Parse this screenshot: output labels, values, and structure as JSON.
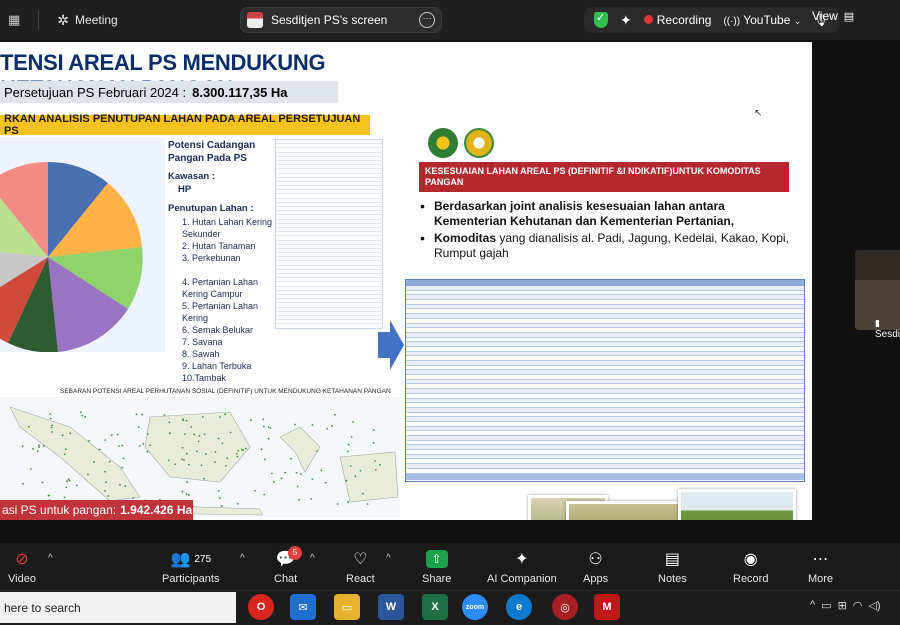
{
  "topbar": {
    "meeting_label": "Meeting",
    "share_title": "Sesditjen PS's screen",
    "recording_label": "Recording",
    "youtube_label": "YouTube",
    "view_label": "View"
  },
  "slide": {
    "title": "TENSI AREAL PS MENDUKUNG KETAHANAN PANGAN",
    "subtitle_prefix": "Persetujuan PS Februari 2024 :",
    "subtitle_value": "8.300.117,35  Ha",
    "yellow_heading": "RKAN ANALISIS PENUTUPAN LAHAN PADA AREAL PERSETUJUAN PS",
    "cadangan_heading": "Potensi Cadangan Pangan Pada PS",
    "kawasan_label": "Kawasan :",
    "kawasan_value": "HP",
    "penutupan_label": "Penutupan Lahan :",
    "lahan_items": [
      "1. Hutan Lahan Kering Sekunder",
      "2. Hutan Tanaman",
      "3. Perkebunan",
      "4. Pertanian Lahan Kering Campur",
      "5. Pertanian Lahan Kering",
      "6. Semak Belukar",
      "7. Savana",
      "8. Sawah",
      "9. Lahan Terbuka",
      "10.Tambak"
    ],
    "map_title": "SEBARAN POTENSI AREAL PERHUTANAN SOSIAL (DEFINITIF) UNTUK MENDUKUNG KETAHANAN PANGAN",
    "luas_prefix": "asi PS untuk pangan:",
    "luas_value": "1.942.426 Ha",
    "red_heading": "KESESUAIAN LAHAN AREAL PS (DEFINITIF &I NDIKATIF)UNTUK KOMODITAS PANGAN",
    "bullet1": "Berdasarkan joint analisis kesesuaian lahan antara Kementerian Kehutanan dan Kementerian Pertanian,",
    "bullet2_bold": "Komoditas",
    "bullet2_rest": "yang dianalisis al. Padi, Jagung, Kedelai, Kakao, Kopi, Rumput gajah"
  },
  "participant": {
    "name": "Sesdi"
  },
  "toolbar": {
    "video": "Video",
    "participants": "Participants",
    "participants_count": "275",
    "chat": "Chat",
    "chat_badge": "5",
    "react": "React",
    "share": "Share",
    "ai": "AI Companion",
    "apps": "Apps",
    "notes": "Notes",
    "record": "Record",
    "more": "More"
  },
  "taskbar": {
    "search_placeholder": "here to search"
  },
  "colors": {
    "title_blue": "#0a2d6b",
    "accent_red": "#c0333a",
    "highlight_yellow": "#f6c21d"
  }
}
